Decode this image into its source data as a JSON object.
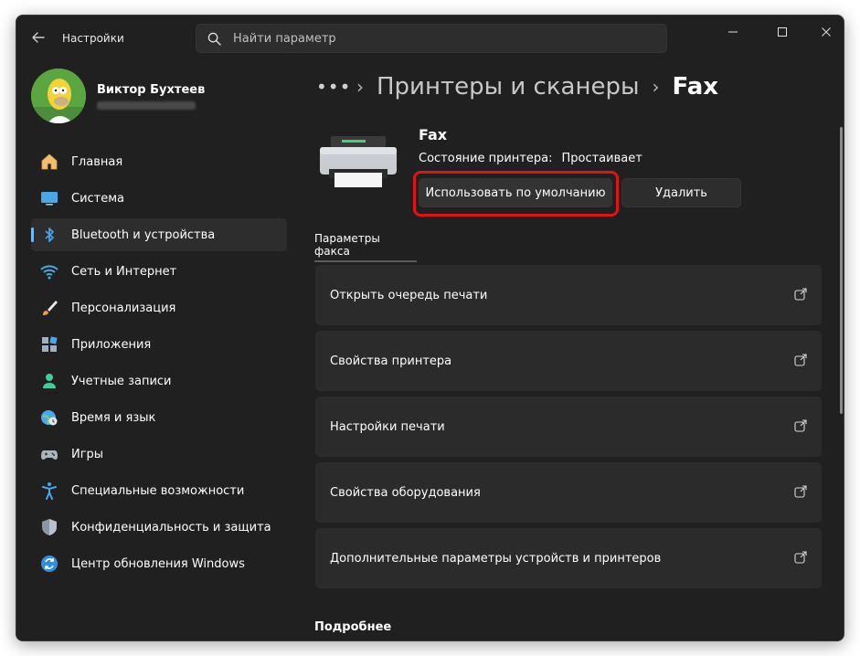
{
  "window": {
    "app_title": "Настройки",
    "search_placeholder": "Найти параметр"
  },
  "profile": {
    "name": "Виктор Бухтеев"
  },
  "sidebar": {
    "items": [
      {
        "label": "Главная",
        "icon": "home-icon"
      },
      {
        "label": "Система",
        "icon": "monitor-icon"
      },
      {
        "label": "Bluetooth и устройства",
        "icon": "bluetooth-icon",
        "active": true
      },
      {
        "label": "Сеть и Интернет",
        "icon": "wifi-icon"
      },
      {
        "label": "Персонализация",
        "icon": "brush-icon"
      },
      {
        "label": "Приложения",
        "icon": "apps-icon"
      },
      {
        "label": "Учетные записи",
        "icon": "person-icon"
      },
      {
        "label": "Время и язык",
        "icon": "globe-clock-icon"
      },
      {
        "label": "Игры",
        "icon": "gamepad-icon"
      },
      {
        "label": "Специальные возможности",
        "icon": "accessibility-icon"
      },
      {
        "label": "Конфиденциальность и защита",
        "icon": "shield-icon"
      },
      {
        "label": "Центр обновления Windows",
        "icon": "update-icon"
      }
    ]
  },
  "breadcrumb": {
    "dots": "•••",
    "parent": "Принтеры и сканеры",
    "current": "Fax"
  },
  "printer": {
    "name": "Fax",
    "status_label": "Состояние принтера:",
    "status_value": "Простаивает"
  },
  "actions": {
    "set_default": "Использовать по умолчанию",
    "remove": "Удалить"
  },
  "tabs": {
    "fax_settings": "Параметры факса"
  },
  "cards": [
    {
      "label": "Открыть очередь печати"
    },
    {
      "label": "Свойства принтера"
    },
    {
      "label": "Настройки печати"
    },
    {
      "label": "Свойства оборудования"
    },
    {
      "label": "Дополнительные параметры устройств и принтеров"
    }
  ],
  "more": {
    "title": "Подробнее"
  },
  "colors": {
    "accent": "#76b9ed",
    "highlight": "#e0121a",
    "window_bg": "#202020",
    "card_bg": "#2b2b2b"
  }
}
